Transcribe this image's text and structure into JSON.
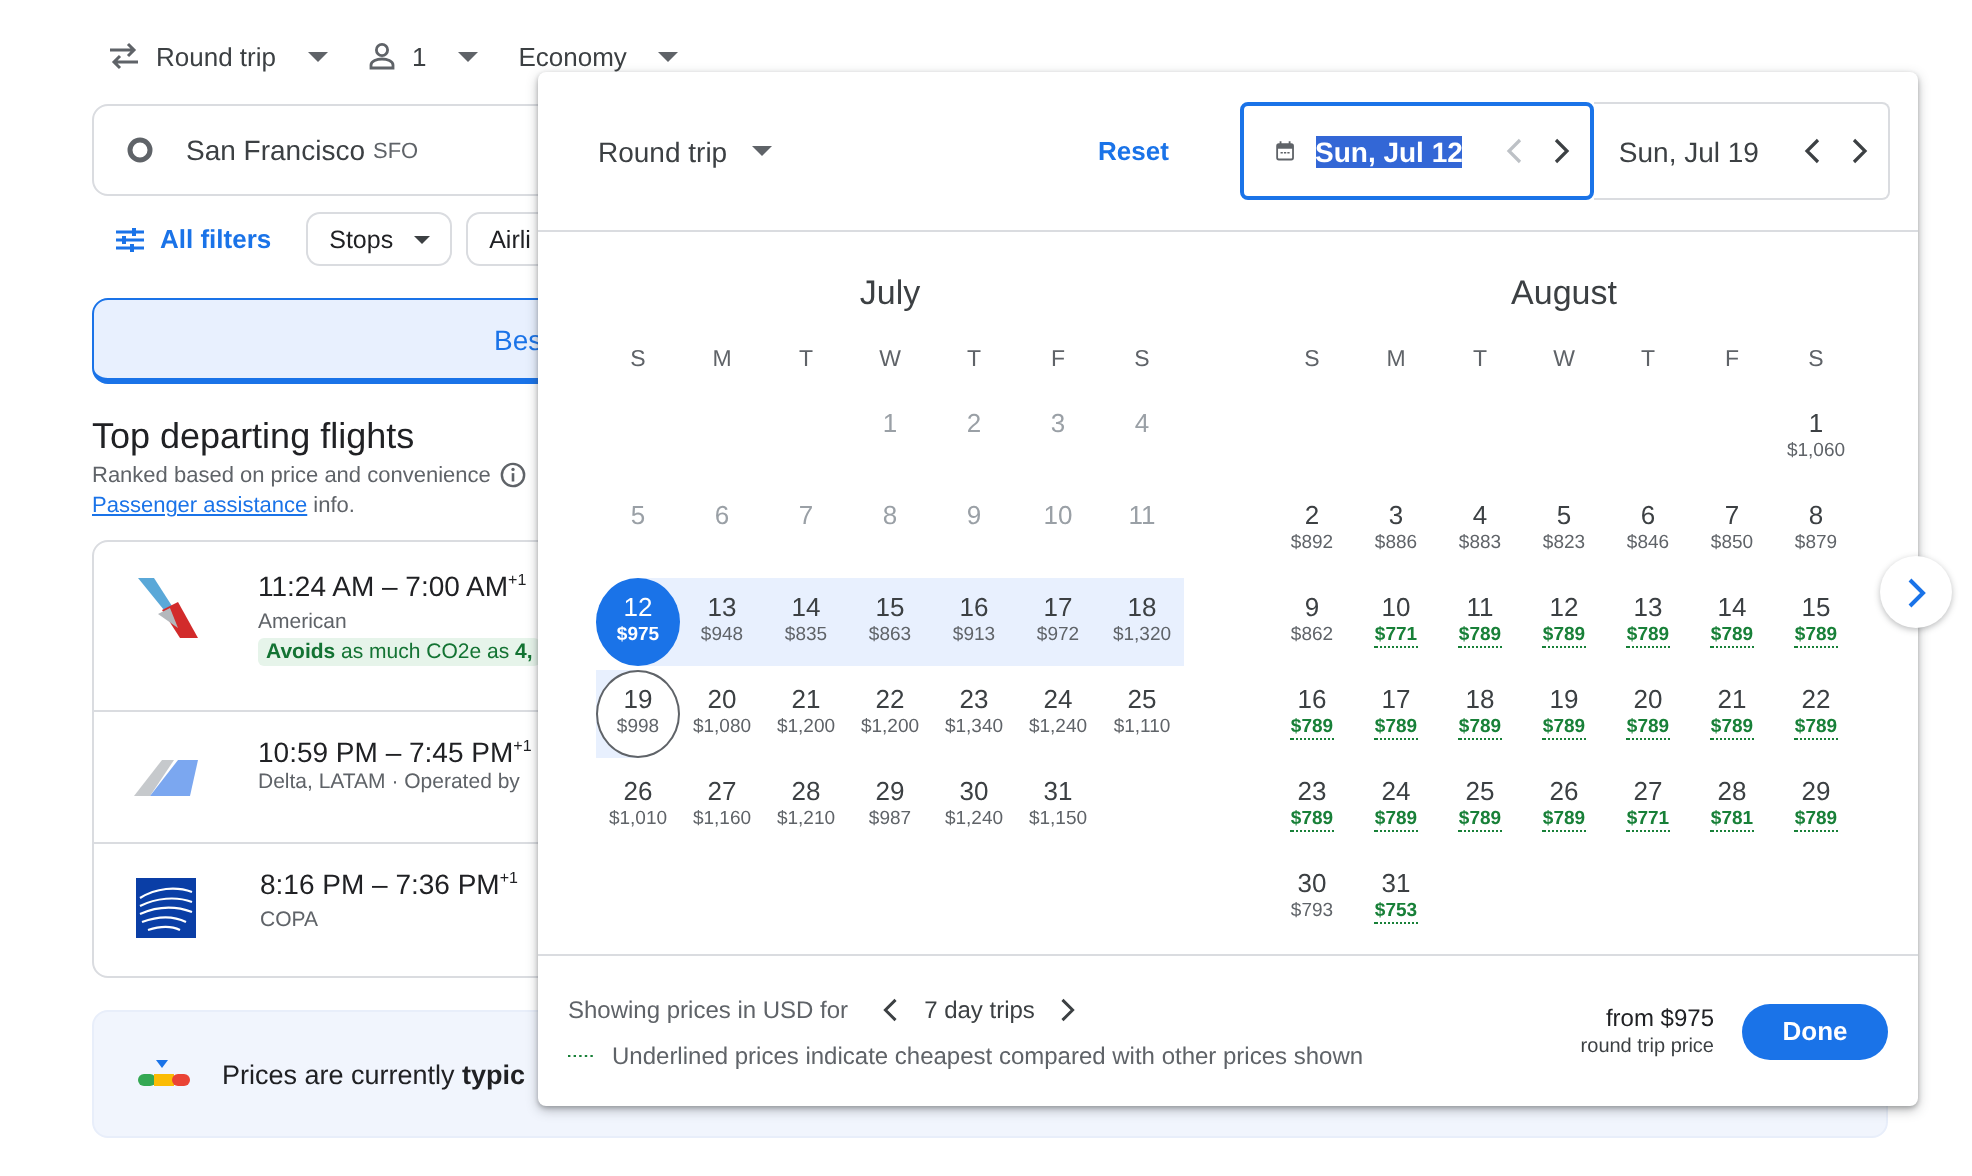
{
  "top_bar": {
    "trip_type": "Round trip",
    "passengers": "1",
    "cabin": "Economy"
  },
  "origin": {
    "city": "San Francisco",
    "code": "SFO"
  },
  "filters": {
    "all_filters": "All filters",
    "chips": [
      "Stops",
      "Airli"
    ]
  },
  "tabs": [
    {
      "label": "Bes",
      "selected": true
    }
  ],
  "section": {
    "title": "Top departing flights",
    "subtitle": "Ranked based on price and convenience",
    "link": "Passenger assistance",
    "link_suffix": " info."
  },
  "flights": [
    {
      "kind": "tail",
      "times": "11:24 AM – 7:00 AM$^{+1}$",
      "airline": "American",
      "badge": "**Avoids** as much CO2e as **4,**"
    },
    {
      "kind": "wing",
      "times": "10:59 PM – 7:45 PM$^{+1}$",
      "airline": "Delta, LATAM · Operated by"
    },
    {
      "kind": "globe",
      "times": "8:16 PM – 7:36 PM$^{+1}$",
      "airline": "COPA"
    }
  ],
  "price_insight": "Prices are currently **typic**",
  "dialog": {
    "trip_type": "Round trip",
    "reset": "Reset",
    "dates": [
      {
        "value": "Sun, Jul 12",
        "focused": true,
        "prev_disabled": true
      },
      {
        "value": "Sun, Jul 19",
        "focused": false,
        "prev_disabled": false
      }
    ],
    "months": [
      {
        "name": "July",
        "weekdays": [
          "S",
          "M",
          "T",
          "W",
          "T",
          "F",
          "S"
        ],
        "weeks": [
          [
            {
              "kind": "empty"
            },
            {
              "kind": "empty"
            },
            {
              "kind": "empty"
            },
            {
              "kind": "past",
              "day": "1"
            },
            {
              "kind": "past",
              "day": "2"
            },
            {
              "kind": "past",
              "day": "3"
            },
            {
              "kind": "past",
              "day": "4"
            }
          ],
          [
            {
              "kind": "past",
              "day": "5"
            },
            {
              "kind": "past",
              "day": "6"
            },
            {
              "kind": "past",
              "day": "7"
            },
            {
              "kind": "past",
              "day": "8"
            },
            {
              "kind": "past",
              "day": "9"
            },
            {
              "kind": "past",
              "day": "10"
            },
            {
              "kind": "past",
              "day": "11"
            }
          ],
          [
            {
              "kind": "day",
              "day": "12",
              "price": "$975",
              "selected": true,
              "in_range": true,
              "cheapest": false
            },
            {
              "kind": "day",
              "day": "13",
              "price": "$948",
              "selected": false,
              "in_range": true,
              "cheapest": false
            },
            {
              "kind": "day",
              "day": "14",
              "price": "$835",
              "selected": false,
              "in_range": true,
              "cheapest": false
            },
            {
              "kind": "day",
              "day": "15",
              "price": "$863",
              "selected": false,
              "in_range": true,
              "cheapest": false
            },
            {
              "kind": "day",
              "day": "16",
              "price": "$913",
              "selected": false,
              "in_range": true,
              "cheapest": false
            },
            {
              "kind": "day",
              "day": "17",
              "price": "$972",
              "selected": false,
              "in_range": true,
              "cheapest": false
            },
            {
              "kind": "day",
              "day": "18",
              "price": "$1,320",
              "selected": false,
              "in_range": true,
              "cheapest": false
            }
          ],
          [
            {
              "kind": "day",
              "day": "19",
              "price": "$998",
              "selected": true,
              "in_range": true,
              "cheapest": false
            },
            {
              "kind": "day",
              "day": "20",
              "price": "$1,080",
              "selected": false,
              "in_range": false,
              "cheapest": false
            },
            {
              "kind": "day",
              "day": "21",
              "price": "$1,200",
              "selected": false,
              "in_range": false,
              "cheapest": false
            },
            {
              "kind": "day",
              "day": "22",
              "price": "$1,200",
              "selected": false,
              "in_range": false,
              "cheapest": false
            },
            {
              "kind": "day",
              "day": "23",
              "price": "$1,340",
              "selected": false,
              "in_range": false,
              "cheapest": false
            },
            {
              "kind": "day",
              "day": "24",
              "price": "$1,240",
              "selected": false,
              "in_range": false,
              "cheapest": false
            },
            {
              "kind": "day",
              "day": "25",
              "price": "$1,110",
              "selected": false,
              "in_range": false,
              "cheapest": false
            }
          ],
          [
            {
              "kind": "day",
              "day": "26",
              "price": "$1,010",
              "selected": false,
              "in_range": false,
              "cheapest": false
            },
            {
              "kind": "day",
              "day": "27",
              "price": "$1,160",
              "selected": false,
              "in_range": false,
              "cheapest": false
            },
            {
              "kind": "day",
              "day": "28",
              "price": "$1,210",
              "selected": false,
              "in_range": false,
              "cheapest": false
            },
            {
              "kind": "day",
              "day": "29",
              "price": "$987",
              "selected": false,
              "in_range": false,
              "cheapest": false
            },
            {
              "kind": "day",
              "day": "30",
              "price": "$1,240",
              "selected": false,
              "in_range": false,
              "cheapest": false
            },
            {
              "kind": "day",
              "day": "31",
              "price": "$1,150",
              "selected": false,
              "in_range": false,
              "cheapest": false
            }
          ]
        ]
      },
      {
        "name": "August",
        "weekdays": [
          "S",
          "M",
          "T",
          "W",
          "T",
          "F",
          "S"
        ],
        "weeks": [
          [
            {
              "kind": "empty"
            },
            {
              "kind": "empty"
            },
            {
              "kind": "empty"
            },
            {
              "kind": "empty"
            },
            {
              "kind": "empty"
            },
            {
              "kind": "empty"
            },
            {
              "kind": "day",
              "day": "1",
              "price": "$1,060",
              "selected": false,
              "in_range": false,
              "cheapest": false
            }
          ],
          [
            {
              "kind": "day",
              "day": "2",
              "price": "$892",
              "selected": false,
              "in_range": false,
              "cheapest": false
            },
            {
              "kind": "day",
              "day": "3",
              "price": "$886",
              "selected": false,
              "in_range": false,
              "cheapest": false
            },
            {
              "kind": "day",
              "day": "4",
              "price": "$883",
              "selected": false,
              "in_range": false,
              "cheapest": false
            },
            {
              "kind": "day",
              "day": "5",
              "price": "$823",
              "selected": false,
              "in_range": false,
              "cheapest": false
            },
            {
              "kind": "day",
              "day": "6",
              "price": "$846",
              "selected": false,
              "in_range": false,
              "cheapest": false
            },
            {
              "kind": "day",
              "day": "7",
              "price": "$850",
              "selected": false,
              "in_range": false,
              "cheapest": false
            },
            {
              "kind": "day",
              "day": "8",
              "price": "$879",
              "selected": false,
              "in_range": false,
              "cheapest": false
            }
          ],
          [
            {
              "kind": "day",
              "day": "9",
              "price": "$862",
              "selected": false,
              "in_range": false,
              "cheapest": false
            },
            {
              "kind": "day",
              "day": "10",
              "price": "$771",
              "selected": false,
              "in_range": false,
              "cheapest": true
            },
            {
              "kind": "day",
              "day": "11",
              "price": "$789",
              "selected": false,
              "in_range": false,
              "cheapest": true
            },
            {
              "kind": "day",
              "day": "12",
              "price": "$789",
              "selected": false,
              "in_range": false,
              "cheapest": true
            },
            {
              "kind": "day",
              "day": "13",
              "price": "$789",
              "selected": false,
              "in_range": false,
              "cheapest": true
            },
            {
              "kind": "day",
              "day": "14",
              "price": "$789",
              "selected": false,
              "in_range": false,
              "cheapest": true
            },
            {
              "kind": "day",
              "day": "15",
              "price": "$789",
              "selected": false,
              "in_range": false,
              "cheapest": true
            }
          ],
          [
            {
              "kind": "day",
              "day": "16",
              "price": "$789",
              "selected": false,
              "in_range": false,
              "cheapest": true
            },
            {
              "kind": "day",
              "day": "17",
              "price": "$789",
              "selected": false,
              "in_range": false,
              "cheapest": true
            },
            {
              "kind": "day",
              "day": "18",
              "price": "$789",
              "selected": false,
              "in_range": false,
              "cheapest": true
            },
            {
              "kind": "day",
              "day": "19",
              "price": "$789",
              "selected": false,
              "in_range": false,
              "cheapest": true
            },
            {
              "kind": "day",
              "day": "20",
              "price": "$789",
              "selected": false,
              "in_range": false,
              "cheapest": true
            },
            {
              "kind": "day",
              "day": "21",
              "price": "$789",
              "selected": false,
              "in_range": false,
              "cheapest": true
            },
            {
              "kind": "day",
              "day": "22",
              "price": "$789",
              "selected": false,
              "in_range": false,
              "cheapest": true
            }
          ],
          [
            {
              "kind": "day",
              "day": "23",
              "price": "$789",
              "selected": false,
              "in_range": false,
              "cheapest": true
            },
            {
              "kind": "day",
              "day": "24",
              "price": "$789",
              "selected": false,
              "in_range": false,
              "cheapest": true
            },
            {
              "kind": "day",
              "day": "25",
              "price": "$789",
              "selected": false,
              "in_range": false,
              "cheapest": true
            },
            {
              "kind": "day",
              "day": "26",
              "price": "$789",
              "selected": false,
              "in_range": false,
              "cheapest": true
            },
            {
              "kind": "day",
              "day": "27",
              "price": "$771",
              "selected": false,
              "in_range": false,
              "cheapest": true
            },
            {
              "kind": "day",
              "day": "28",
              "price": "$781",
              "selected": false,
              "in_range": false,
              "cheapest": true
            },
            {
              "kind": "day",
              "day": "29",
              "price": "$789",
              "selected": false,
              "in_range": false,
              "cheapest": true
            }
          ],
          [
            {
              "kind": "day",
              "day": "30",
              "price": "$793",
              "selected": false,
              "in_range": false,
              "cheapest": false
            },
            {
              "kind": "day",
              "day": "31",
              "price": "$753",
              "selected": false,
              "in_range": false,
              "cheapest": true
            }
          ]
        ]
      }
    ],
    "footer": {
      "currency_note": "Showing prices in USD for",
      "trip_length": "7 day trips",
      "legend": "Underlined prices indicate cheapest compared with other prices shown",
      "from_price": "from $975",
      "price_note": "round trip price",
      "done": "Done"
    }
  }
}
